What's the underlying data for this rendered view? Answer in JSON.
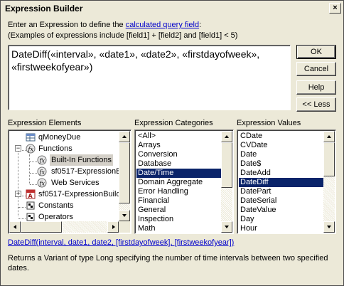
{
  "window": {
    "title": "Expression Builder",
    "close_glyph": "×"
  },
  "instructions": {
    "line1_prefix": "Enter an Expression to define the ",
    "line1_link": "calculated query field",
    "line1_suffix": ":",
    "line2": "(Examples of expressions include [field1] + [field2] and [field1] < 5)"
  },
  "expression": {
    "text": "DateDiff(«interval», «date1», «date2», «firstdayofweek», «firstweekofyear»)"
  },
  "buttons": {
    "ok": "OK",
    "cancel": "Cancel",
    "help": "Help",
    "less": "<< Less"
  },
  "elements": {
    "label": "Expression Elements",
    "items": [
      {
        "label": "qMoneyDue",
        "icon": "query-icon"
      },
      {
        "label": "Functions",
        "icon": "function-icon",
        "toggle": "−"
      },
      {
        "label": "Built-In Functions",
        "icon": "function-icon",
        "selected": true
      },
      {
        "label": "sf0517-ExpressionB",
        "icon": "function-icon"
      },
      {
        "label": "Web Services",
        "icon": "function-icon"
      },
      {
        "label": "sf0517-ExpressionBuild",
        "icon": "database-icon",
        "toggle": "+"
      },
      {
        "label": "Constants",
        "icon": "folder-icon"
      },
      {
        "label": "Operators",
        "icon": "folder-icon"
      }
    ]
  },
  "categories": {
    "label": "Expression Categories",
    "items": [
      "<All>",
      "Arrays",
      "Conversion",
      "Database",
      "Date/Time",
      "Domain Aggregate",
      "Error Handling",
      "Financial",
      "General",
      "Inspection",
      "Math"
    ],
    "selected": "Date/Time"
  },
  "values": {
    "label": "Expression Values",
    "items": [
      "CDate",
      "CVDate",
      "Date",
      "Date$",
      "DateAdd",
      "DateDiff",
      "DatePart",
      "DateSerial",
      "DateValue",
      "Day",
      "Hour"
    ],
    "selected": "DateDiff"
  },
  "syntax": {
    "link": "DateDiff(interval, date1, date2, [firstdayofweek], [firstweekofyear])"
  },
  "description": {
    "text": "Returns a Variant of type Long specifying the number of time intervals between two specified dates."
  },
  "colors": {
    "selection": "#0a246a",
    "link": "#0000cc",
    "dialog_bg": "#ece9d8"
  }
}
